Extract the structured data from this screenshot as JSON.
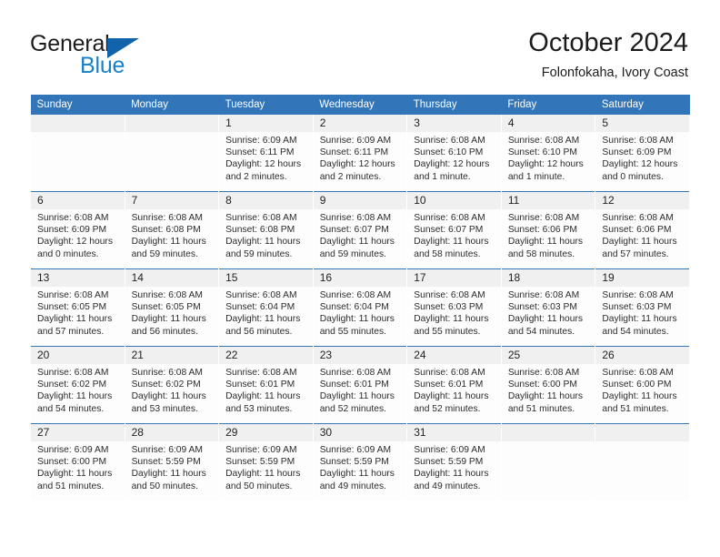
{
  "brand": {
    "name_top": "General",
    "name_bottom": "Blue",
    "triangle_color": "#1164ab",
    "blue_color": "#1880c9"
  },
  "header": {
    "title": "October 2024",
    "subtitle": "Folonfokaha, Ivory Coast"
  },
  "theme": {
    "header_row_bg": "#3275b8",
    "header_row_text": "#ffffff",
    "daynum_bar_bg": "#f0f0f0",
    "week_separator": "#3275b8",
    "cell_bg": "#fdfdfd"
  },
  "weekday_headers": [
    "Sunday",
    "Monday",
    "Tuesday",
    "Wednesday",
    "Thursday",
    "Friday",
    "Saturday"
  ],
  "labels": {
    "sunrise_prefix": "Sunrise:",
    "sunset_prefix": "Sunset:",
    "daylight_prefix": "Daylight:"
  },
  "weeks": [
    [
      {
        "day": "",
        "sunrise": "",
        "sunset": "",
        "daylight": ""
      },
      {
        "day": "",
        "sunrise": "",
        "sunset": "",
        "daylight": ""
      },
      {
        "day": "1",
        "sunrise": "Sunrise: 6:09 AM",
        "sunset": "Sunset: 6:11 PM",
        "daylight": "Daylight: 12 hours and 2 minutes."
      },
      {
        "day": "2",
        "sunrise": "Sunrise: 6:09 AM",
        "sunset": "Sunset: 6:11 PM",
        "daylight": "Daylight: 12 hours and 2 minutes."
      },
      {
        "day": "3",
        "sunrise": "Sunrise: 6:08 AM",
        "sunset": "Sunset: 6:10 PM",
        "daylight": "Daylight: 12 hours and 1 minute."
      },
      {
        "day": "4",
        "sunrise": "Sunrise: 6:08 AM",
        "sunset": "Sunset: 6:10 PM",
        "daylight": "Daylight: 12 hours and 1 minute."
      },
      {
        "day": "5",
        "sunrise": "Sunrise: 6:08 AM",
        "sunset": "Sunset: 6:09 PM",
        "daylight": "Daylight: 12 hours and 0 minutes."
      }
    ],
    [
      {
        "day": "6",
        "sunrise": "Sunrise: 6:08 AM",
        "sunset": "Sunset: 6:09 PM",
        "daylight": "Daylight: 12 hours and 0 minutes."
      },
      {
        "day": "7",
        "sunrise": "Sunrise: 6:08 AM",
        "sunset": "Sunset: 6:08 PM",
        "daylight": "Daylight: 11 hours and 59 minutes."
      },
      {
        "day": "8",
        "sunrise": "Sunrise: 6:08 AM",
        "sunset": "Sunset: 6:08 PM",
        "daylight": "Daylight: 11 hours and 59 minutes."
      },
      {
        "day": "9",
        "sunrise": "Sunrise: 6:08 AM",
        "sunset": "Sunset: 6:07 PM",
        "daylight": "Daylight: 11 hours and 59 minutes."
      },
      {
        "day": "10",
        "sunrise": "Sunrise: 6:08 AM",
        "sunset": "Sunset: 6:07 PM",
        "daylight": "Daylight: 11 hours and 58 minutes."
      },
      {
        "day": "11",
        "sunrise": "Sunrise: 6:08 AM",
        "sunset": "Sunset: 6:06 PM",
        "daylight": "Daylight: 11 hours and 58 minutes."
      },
      {
        "day": "12",
        "sunrise": "Sunrise: 6:08 AM",
        "sunset": "Sunset: 6:06 PM",
        "daylight": "Daylight: 11 hours and 57 minutes."
      }
    ],
    [
      {
        "day": "13",
        "sunrise": "Sunrise: 6:08 AM",
        "sunset": "Sunset: 6:05 PM",
        "daylight": "Daylight: 11 hours and 57 minutes."
      },
      {
        "day": "14",
        "sunrise": "Sunrise: 6:08 AM",
        "sunset": "Sunset: 6:05 PM",
        "daylight": "Daylight: 11 hours and 56 minutes."
      },
      {
        "day": "15",
        "sunrise": "Sunrise: 6:08 AM",
        "sunset": "Sunset: 6:04 PM",
        "daylight": "Daylight: 11 hours and 56 minutes."
      },
      {
        "day": "16",
        "sunrise": "Sunrise: 6:08 AM",
        "sunset": "Sunset: 6:04 PM",
        "daylight": "Daylight: 11 hours and 55 minutes."
      },
      {
        "day": "17",
        "sunrise": "Sunrise: 6:08 AM",
        "sunset": "Sunset: 6:03 PM",
        "daylight": "Daylight: 11 hours and 55 minutes."
      },
      {
        "day": "18",
        "sunrise": "Sunrise: 6:08 AM",
        "sunset": "Sunset: 6:03 PM",
        "daylight": "Daylight: 11 hours and 54 minutes."
      },
      {
        "day": "19",
        "sunrise": "Sunrise: 6:08 AM",
        "sunset": "Sunset: 6:03 PM",
        "daylight": "Daylight: 11 hours and 54 minutes."
      }
    ],
    [
      {
        "day": "20",
        "sunrise": "Sunrise: 6:08 AM",
        "sunset": "Sunset: 6:02 PM",
        "daylight": "Daylight: 11 hours and 54 minutes."
      },
      {
        "day": "21",
        "sunrise": "Sunrise: 6:08 AM",
        "sunset": "Sunset: 6:02 PM",
        "daylight": "Daylight: 11 hours and 53 minutes."
      },
      {
        "day": "22",
        "sunrise": "Sunrise: 6:08 AM",
        "sunset": "Sunset: 6:01 PM",
        "daylight": "Daylight: 11 hours and 53 minutes."
      },
      {
        "day": "23",
        "sunrise": "Sunrise: 6:08 AM",
        "sunset": "Sunset: 6:01 PM",
        "daylight": "Daylight: 11 hours and 52 minutes."
      },
      {
        "day": "24",
        "sunrise": "Sunrise: 6:08 AM",
        "sunset": "Sunset: 6:01 PM",
        "daylight": "Daylight: 11 hours and 52 minutes."
      },
      {
        "day": "25",
        "sunrise": "Sunrise: 6:08 AM",
        "sunset": "Sunset: 6:00 PM",
        "daylight": "Daylight: 11 hours and 51 minutes."
      },
      {
        "day": "26",
        "sunrise": "Sunrise: 6:08 AM",
        "sunset": "Sunset: 6:00 PM",
        "daylight": "Daylight: 11 hours and 51 minutes."
      }
    ],
    [
      {
        "day": "27",
        "sunrise": "Sunrise: 6:09 AM",
        "sunset": "Sunset: 6:00 PM",
        "daylight": "Daylight: 11 hours and 51 minutes."
      },
      {
        "day": "28",
        "sunrise": "Sunrise: 6:09 AM",
        "sunset": "Sunset: 5:59 PM",
        "daylight": "Daylight: 11 hours and 50 minutes."
      },
      {
        "day": "29",
        "sunrise": "Sunrise: 6:09 AM",
        "sunset": "Sunset: 5:59 PM",
        "daylight": "Daylight: 11 hours and 50 minutes."
      },
      {
        "day": "30",
        "sunrise": "Sunrise: 6:09 AM",
        "sunset": "Sunset: 5:59 PM",
        "daylight": "Daylight: 11 hours and 49 minutes."
      },
      {
        "day": "31",
        "sunrise": "Sunrise: 6:09 AM",
        "sunset": "Sunset: 5:59 PM",
        "daylight": "Daylight: 11 hours and 49 minutes."
      },
      {
        "day": "",
        "sunrise": "",
        "sunset": "",
        "daylight": ""
      },
      {
        "day": "",
        "sunrise": "",
        "sunset": "",
        "daylight": ""
      }
    ]
  ]
}
